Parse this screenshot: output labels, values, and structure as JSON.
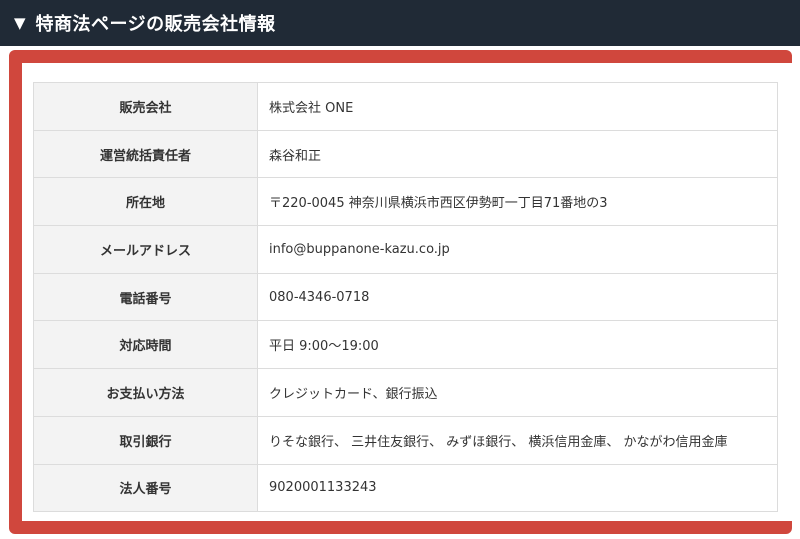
{
  "header": {
    "marker": "▼",
    "title": "特商法ページの販売会社情報"
  },
  "colors": {
    "header_bg": "#202a36",
    "frame": "#d0473d",
    "label_bg": "#f3f3f3",
    "border": "#dcdcdc"
  },
  "rows": [
    {
      "label": "販売会社",
      "value": "株式会社 ONE"
    },
    {
      "label": "運営統括責任者",
      "value": "森谷和正"
    },
    {
      "label": "所在地",
      "value": "〒220-0045 神奈川県横浜市西区伊勢町一丁目71番地の3"
    },
    {
      "label": "メールアドレス",
      "value": "info@buppanone-kazu.co.jp"
    },
    {
      "label": "電話番号",
      "value": "080-4346-0718"
    },
    {
      "label": "対応時間",
      "value": "平日 9:00〜19:00"
    },
    {
      "label": "お支払い方法",
      "value": "クレジットカード、銀行振込"
    },
    {
      "label": "取引銀行",
      "value": "りそな銀行、 三井住友銀行、 みずほ銀行、 横浜信用金庫、 かながわ信用金庫"
    },
    {
      "label": "法人番号",
      "value": "9020001133243"
    }
  ]
}
